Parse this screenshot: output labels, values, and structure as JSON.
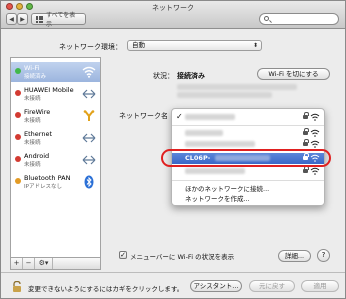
{
  "window": {
    "title": "ネットワーク"
  },
  "toolbar": {
    "back_label": "◀",
    "forward_label": "▶",
    "show_all_label": "すべてを表示",
    "search_placeholder": ""
  },
  "location": {
    "label": "ネットワーク環境：",
    "value": "自動"
  },
  "services": [
    {
      "name": "Wi-Fi",
      "status": "接続済み",
      "dot": "green",
      "icon": "wifi-icon",
      "selected": true
    },
    {
      "name": "HUAWEI Mobile",
      "status": "未接続",
      "dot": "red",
      "icon": "phone-arrows-icon"
    },
    {
      "name": "FireWire",
      "status": "未接続",
      "dot": "red",
      "icon": "firewire-icon"
    },
    {
      "name": "Ethernet",
      "status": "未接続",
      "dot": "red",
      "icon": "ethernet-icon"
    },
    {
      "name": "Android",
      "status": "未接続",
      "dot": "red",
      "icon": "phone-arrows-icon"
    },
    {
      "name": "Bluetooth PAN",
      "status": "IPアドレスなし",
      "dot": "orange",
      "icon": "bluetooth-icon"
    }
  ],
  "sidebar_footer": {
    "add": "+",
    "remove": "−",
    "gear": "⚙▾"
  },
  "detail": {
    "status_label": "状況：",
    "status_value": "接続済み",
    "wifi_off_button": "Wi-Fi を切にする",
    "network_name_label": "ネットワーク名"
  },
  "network_menu": {
    "checkmark": "✓",
    "selected_ssid": "CL06P-",
    "join_other": "ほかのネットワークに接続...",
    "create_network": "ネットワークを作成..."
  },
  "footer": {
    "show_status_label": "メニューバーに Wi-Fi の状況を表示",
    "show_status_checked": true,
    "details_button": "詳細...",
    "help_button": "?",
    "lock_note": "変更できないようにするにはカギをクリックします。",
    "assistant_button": "アシスタント...",
    "revert_button": "元に戻す",
    "apply_button": "適用"
  },
  "colors": {
    "selection": "#9cb5de",
    "highlight": "#3a67c7",
    "annotation": "#e02020"
  }
}
